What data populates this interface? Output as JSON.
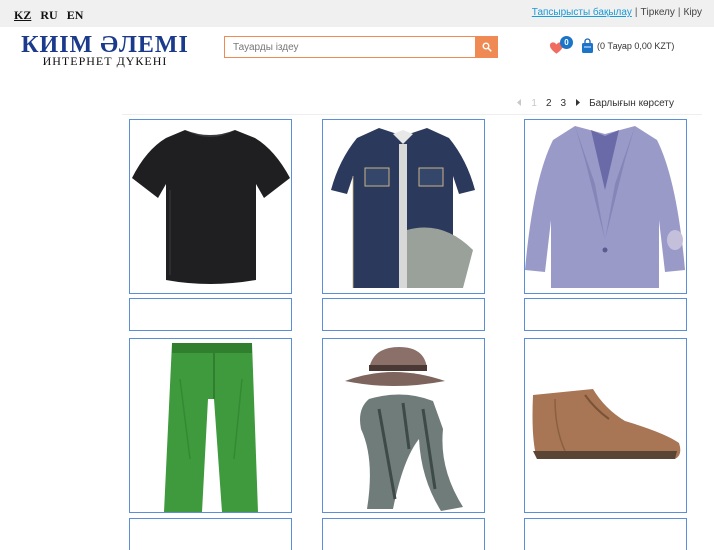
{
  "languages": [
    {
      "code": "KZ",
      "active": true
    },
    {
      "code": "RU",
      "active": false
    },
    {
      "code": "EN",
      "active": false
    }
  ],
  "top_links": {
    "track_order": "Тапсырысты бақылау",
    "register": "Тіркелу",
    "login": "Кіру",
    "separator": "|"
  },
  "logo": {
    "title": "КИІМ ӘЛЕМІ",
    "subtitle": "ИНТЕРНЕТ ДҮКЕНІ"
  },
  "search": {
    "placeholder": "Тауарды іздеу",
    "value": "",
    "button_icon": "search-icon"
  },
  "wishlist": {
    "icon": "heart-icon",
    "count": "0"
  },
  "cart": {
    "icon": "shopping-bag-icon",
    "summary": "(0 Тауар 0,00 KZT)"
  },
  "pagination": {
    "prev_icon": "chevron-left-icon",
    "pages": [
      "1",
      "2",
      "3"
    ],
    "current": "1",
    "next_icon": "chevron-right-icon",
    "show_all": "Барлығын көрсету"
  },
  "products": [
    {
      "image": "black t-shirt",
      "caption": ""
    },
    {
      "image": "denim shirt",
      "caption": ""
    },
    {
      "image": "lavender blazer",
      "caption": ""
    },
    {
      "image": "green trousers",
      "caption": ""
    },
    {
      "image": "hat and scarf",
      "caption": ""
    },
    {
      "image": "brown boot",
      "caption": ""
    }
  ],
  "colors": {
    "accent_orange": "#ef8a55",
    "card_border": "#5b8fd8",
    "logo_blue": "#1b3a8c",
    "link_blue": "#1a9ad6",
    "badge_blue": "#1a75c8",
    "wishlist_heart": "#ef6c5f",
    "topbar_bg": "#f0f0f0"
  }
}
